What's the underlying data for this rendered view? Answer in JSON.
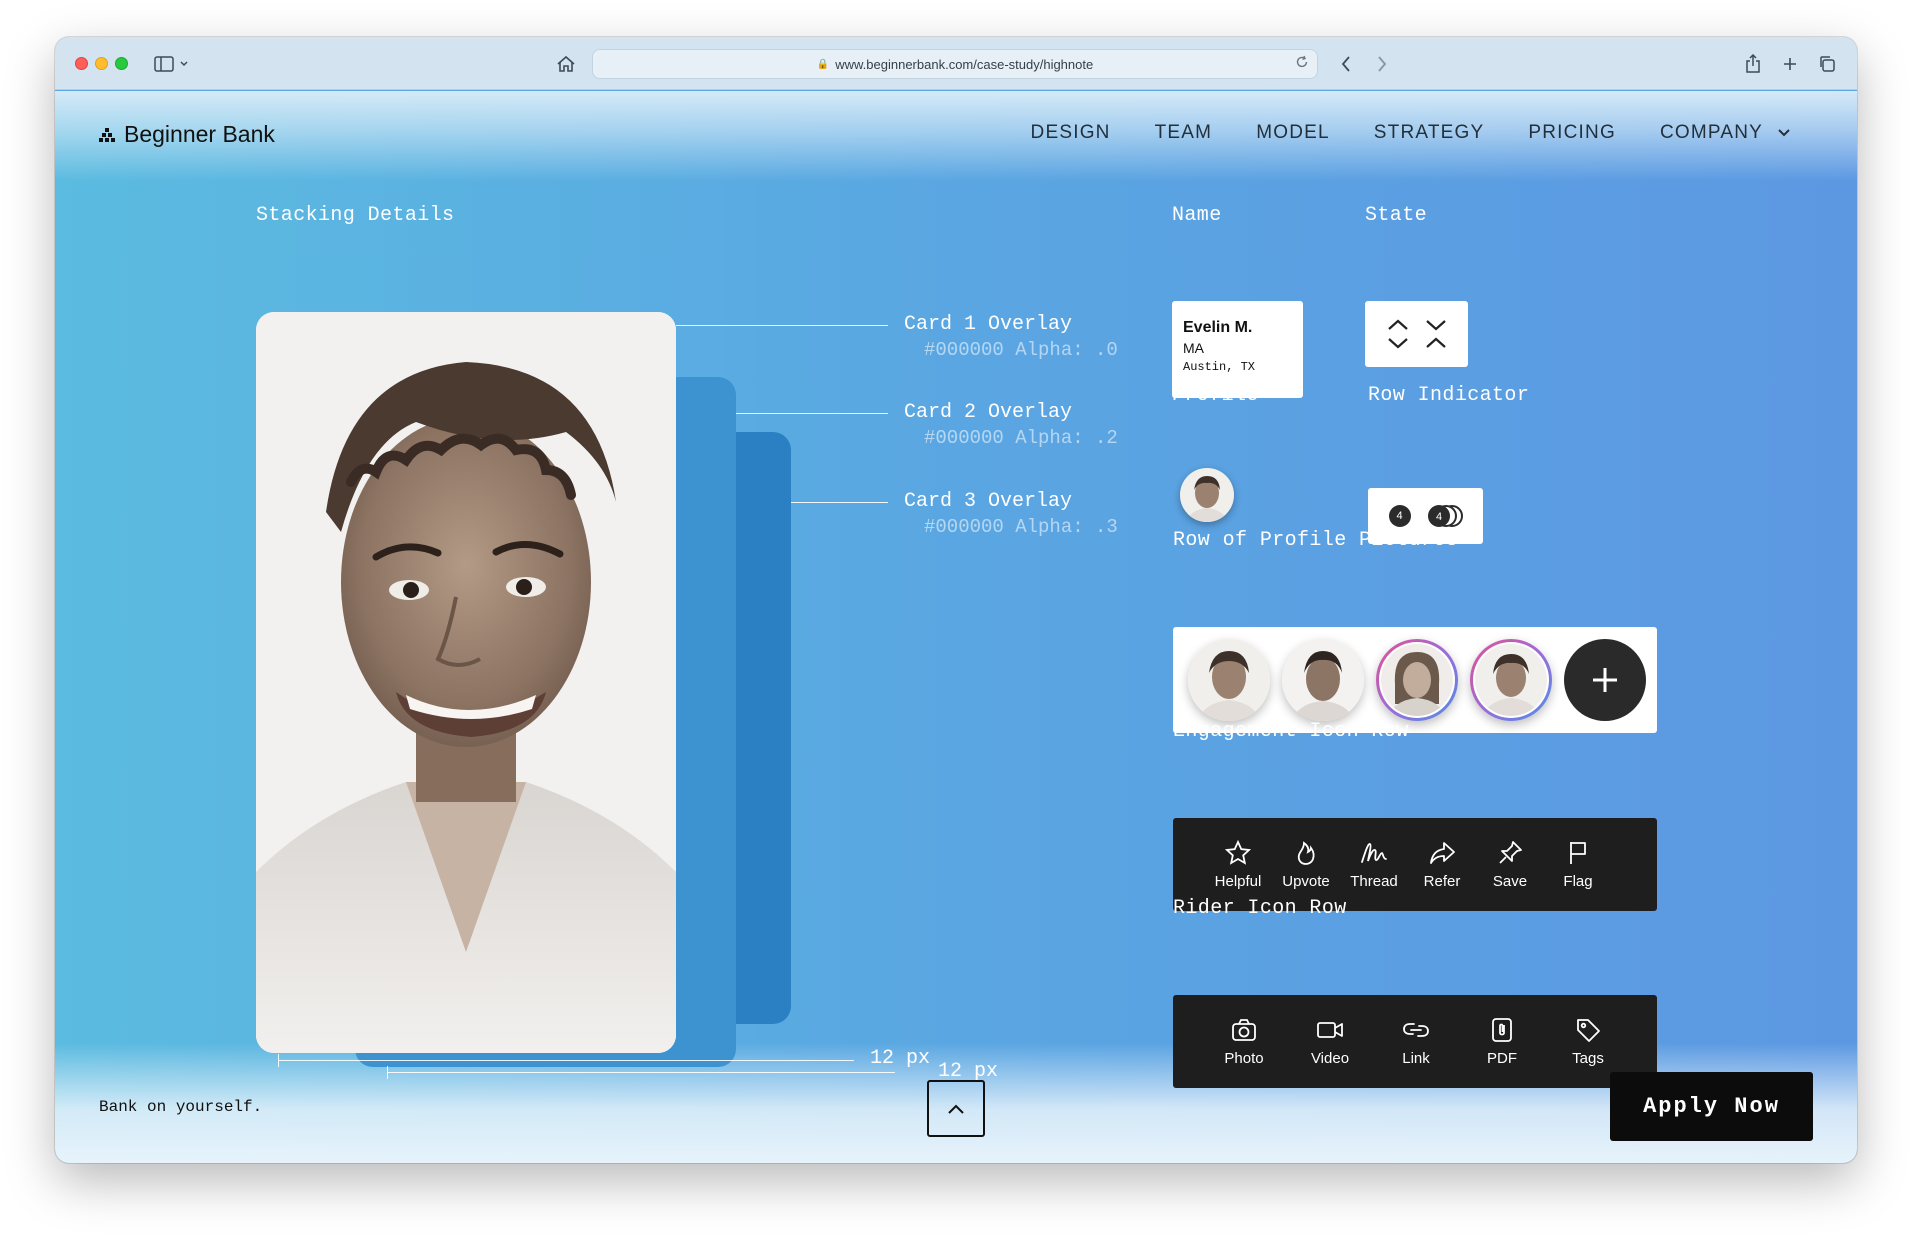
{
  "browser": {
    "url": "www.beginnerbank.com/case-study/highnote"
  },
  "header": {
    "logo_text": "Beginner Bank",
    "nav": [
      {
        "label": "DESIGN"
      },
      {
        "label": "TEAM"
      },
      {
        "label": "MODEL"
      },
      {
        "label": "STRATEGY"
      },
      {
        "label": "PRICING"
      },
      {
        "label": "COMPANY"
      }
    ]
  },
  "stacking": {
    "title": "Stacking Details",
    "overlays": [
      {
        "title": "Card 1 Overlay",
        "detail": "#000000 Alpha: .0"
      },
      {
        "title": "Card 2 Overlay",
        "detail": "#000000 Alpha: .2"
      },
      {
        "title": "Card 3 Overlay",
        "detail": "#000000 Alpha: .3"
      }
    ],
    "spacing_labels": [
      "12 px",
      "12 px"
    ]
  },
  "components": {
    "name_label": "Name",
    "name_card": {
      "name": "Evelin M.",
      "line2": "MA",
      "location": "Austin, TX"
    },
    "state_label": "State",
    "profile_label": "Profile",
    "row_indicator_label": "Row Indicator",
    "row_indicator_count": "4",
    "profiles_row_label": "Row of Profile Pictures",
    "engagement_label": "Engagement Icon Row",
    "engagement_icons": [
      {
        "label": "Helpful",
        "icon": "star-icon"
      },
      {
        "label": "Upvote",
        "icon": "flame-icon"
      },
      {
        "label": "Thread",
        "icon": "signature-icon"
      },
      {
        "label": "Refer",
        "icon": "share-arrow-icon"
      },
      {
        "label": "Save",
        "icon": "pin-icon"
      },
      {
        "label": "Flag",
        "icon": "flag-icon"
      }
    ],
    "rider_label": "Rider Icon Row",
    "rider_icons": [
      {
        "label": "Photo",
        "icon": "camera-icon"
      },
      {
        "label": "Video",
        "icon": "video-icon"
      },
      {
        "label": "Link",
        "icon": "link-icon"
      },
      {
        "label": "PDF",
        "icon": "paperclip-doc-icon"
      },
      {
        "label": "Tags",
        "icon": "tag-icon"
      }
    ]
  },
  "footer": {
    "tagline": "Bank on yourself.",
    "cta": "Apply Now"
  },
  "colors": {
    "page_gradient_start": "#5bbbe0",
    "page_gradient_end": "#5c98e2",
    "card2": "#3d93cf",
    "card3": "#2a80c2",
    "dark_panel": "#1e1e1e",
    "cta_bg": "#0c0c0c"
  }
}
